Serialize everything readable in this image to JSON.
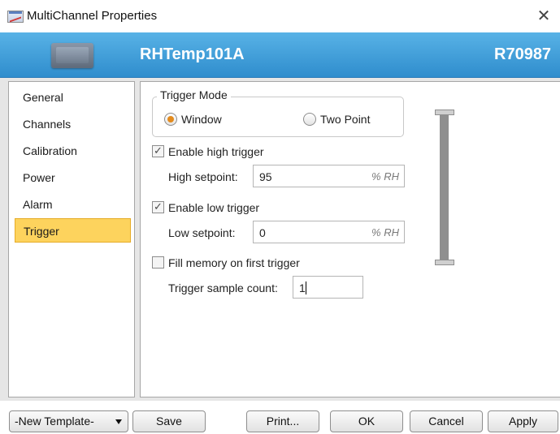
{
  "window": {
    "title": "MultiChannel Properties",
    "close_glyph": "✕"
  },
  "header": {
    "device_name": "RHTemp101A",
    "serial": "R70987",
    "device_image": "device-image"
  },
  "sidebar": {
    "items": [
      {
        "label": "General"
      },
      {
        "label": "Channels"
      },
      {
        "label": "Calibration"
      },
      {
        "label": "Power"
      },
      {
        "label": "Alarm"
      },
      {
        "label": "Trigger",
        "selected": true
      }
    ]
  },
  "trigger": {
    "mode_title": "Trigger Mode",
    "modes": [
      {
        "label": "Window",
        "selected": true
      },
      {
        "label": "Two Point",
        "selected": false
      }
    ],
    "high": {
      "enable_label": "Enable high trigger",
      "checked": true,
      "setpoint_label": "High setpoint:",
      "value": "95",
      "unit": "% RH"
    },
    "low": {
      "enable_label": "Enable low trigger",
      "checked": true,
      "setpoint_label": "Low setpoint:",
      "value": "0",
      "unit": "% RH"
    },
    "fill_memory": {
      "label": "Fill memory on first trigger",
      "checked": false
    },
    "sample_count": {
      "label": "Trigger sample count:",
      "value": "1"
    }
  },
  "footer": {
    "template_select": "-New Template-",
    "save": "Save",
    "print": "Print...",
    "ok": "OK",
    "cancel": "Cancel",
    "apply": "Apply"
  },
  "colors": {
    "header": "#3a9ad8",
    "selection": "#fdd35d",
    "radio_dot": "#e38b1e"
  }
}
